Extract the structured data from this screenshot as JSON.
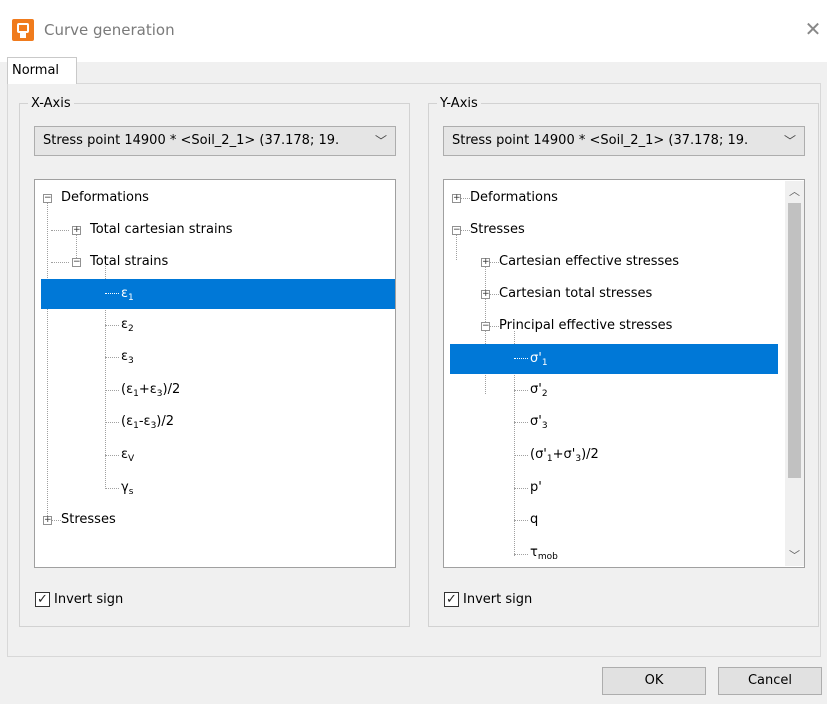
{
  "window": {
    "title": "Curve generation",
    "close_glyph": "✕"
  },
  "tabs": [
    {
      "label": "Normal"
    }
  ],
  "x_axis": {
    "legend": "X-Axis",
    "combo_value": "Stress point 14900 * <Soil_2_1> (37.178; 19.",
    "invert_label": "Invert sign",
    "invert_checked": true,
    "tree": {
      "deformations": "Deformations",
      "total_cartesian_strains": "Total cartesian strains",
      "total_strains": "Total strains",
      "e1": "ε",
      "e1_sub": "1",
      "e2": "ε",
      "e2_sub": "2",
      "e3": "ε",
      "e3_sub": "3",
      "e_avg": "(ε",
      "e_avg_sub1": "1",
      "e_avg_mid": "+ε",
      "e_avg_sub2": "3",
      "e_avg_end": ")/2",
      "e_dif": "(ε",
      "e_dif_sub1": "1",
      "e_dif_mid": "-ε",
      "e_dif_sub2": "3",
      "e_dif_end": ")/2",
      "ev": "ε",
      "ev_sub": "V",
      "gs": "γ",
      "gs_sub": "s",
      "stresses": "Stresses"
    }
  },
  "y_axis": {
    "legend": "Y-Axis",
    "combo_value": "Stress point 14900 * <Soil_2_1> (37.178; 19.",
    "invert_label": "Invert sign",
    "invert_checked": true,
    "tree": {
      "deformations": "Deformations",
      "stresses": "Stresses",
      "cartesian_effective": "Cartesian effective stresses",
      "cartesian_total": "Cartesian total stresses",
      "principal_effective": "Principal effective stresses",
      "s1": "σ'",
      "s1_sub": "1",
      "s2": "σ'",
      "s2_sub": "2",
      "s3": "σ'",
      "s3_sub": "3",
      "s_avg": "(σ'",
      "s_avg_sub1": "1",
      "s_avg_mid": "+σ'",
      "s_avg_sub2": "3",
      "s_avg_end": ")/2",
      "p": "p'",
      "q": "q",
      "tmob": "τ",
      "tmob_sub": "mob"
    }
  },
  "buttons": {
    "ok": "OK",
    "cancel": "Cancel"
  },
  "colors": {
    "selection": "#0078d7",
    "app_icon": "#f07b1d"
  }
}
